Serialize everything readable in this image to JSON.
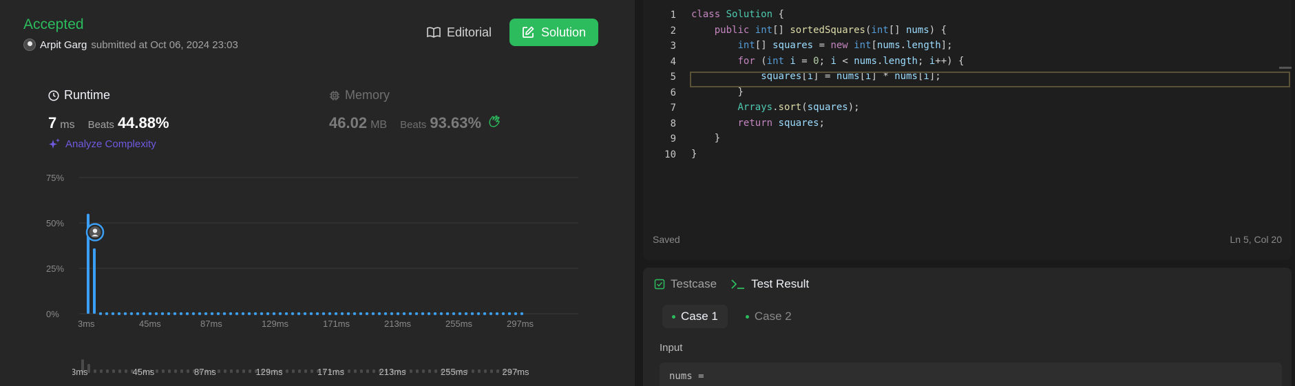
{
  "submission": {
    "status": "Accepted",
    "author": "Arpit Garg",
    "submitted_text": "submitted at Oct 06, 2024 23:03"
  },
  "actions": {
    "editorial_label": "Editorial",
    "solution_label": "Solution"
  },
  "runtime": {
    "label": "Runtime",
    "value": "7",
    "unit": "ms",
    "beats_label": "Beats",
    "beats": "44.88%"
  },
  "memory": {
    "label": "Memory",
    "value": "46.02",
    "unit": "MB",
    "beats_label": "Beats",
    "beats": "93.63%"
  },
  "analyze_label": "Analyze Complexity",
  "chart_data": {
    "type": "bar",
    "title": "",
    "xlabel": "",
    "ylabel": "",
    "y_ticks": [
      "75%",
      "50%",
      "25%",
      "0%"
    ],
    "ylim": [
      0,
      75
    ],
    "x_tick_labels": [
      "3ms",
      "45ms",
      "87ms",
      "129ms",
      "171ms",
      "213ms",
      "255ms",
      "297ms"
    ],
    "series": [
      {
        "values": [
          55,
          36,
          0.8,
          0.8,
          0.8,
          0.8,
          0.8,
          0.8,
          0.8,
          0.8,
          0.8,
          0.8,
          0.8,
          0.8,
          0.8,
          0.8,
          0.8,
          0.8,
          0.8,
          0.8,
          0.8,
          0.8,
          0.8,
          0.8,
          0.8,
          0.8,
          0.8,
          0.8,
          0.8,
          0.8,
          0.8,
          0.8,
          0.8,
          0.8,
          0.8,
          0.8,
          0.8,
          0.8,
          0.8,
          0.8,
          0.8,
          0.8,
          0.8,
          0.8,
          0.8,
          0.8,
          0.8,
          0.8,
          0.8,
          0.8,
          0.8,
          0.8,
          0.8,
          0.8,
          0.8,
          0.8,
          0.8,
          0.8,
          0.8,
          0.8,
          0.8,
          0.8,
          0.8,
          0.8,
          0.8,
          0.8,
          0.8,
          0.8,
          0.8,
          0.8,
          0.8
        ]
      }
    ],
    "user_marker_index": 0,
    "user_marker_value": 44.88,
    "grid": true,
    "bar_color": "#3b9ff5",
    "minimap_tick_labels": [
      "3ms",
      "45ms",
      "87ms",
      "129ms",
      "171ms",
      "213ms",
      "255ms",
      "297ms"
    ]
  },
  "editor": {
    "lines": [
      "class Solution {",
      "    public int[] sortedSquares(int[] nums) {",
      "        int[] squares = new int[nums.length];",
      "        for (int i = 0; i < nums.length; i++) {",
      "            squares[i] = nums[i] * nums[i];",
      "        }",
      "        Arrays.sort(squares);",
      "        return squares;",
      "    }",
      "}"
    ],
    "line_numbers": [
      "1",
      "2",
      "3",
      "4",
      "5",
      "6",
      "7",
      "8",
      "9",
      "10"
    ],
    "saved_label": "Saved",
    "cursor_position": "Ln 5, Col 20"
  },
  "bottom": {
    "testcase_tab": "Testcase",
    "result_tab": "Test Result",
    "case1": "Case 1",
    "case2": "Case 2",
    "input_label": "Input",
    "nums_label": "nums ="
  },
  "colors": {
    "accent_green": "#2cbb5d",
    "bar_blue": "#3b9ff5",
    "analyze_purple": "#6f5ae0"
  }
}
